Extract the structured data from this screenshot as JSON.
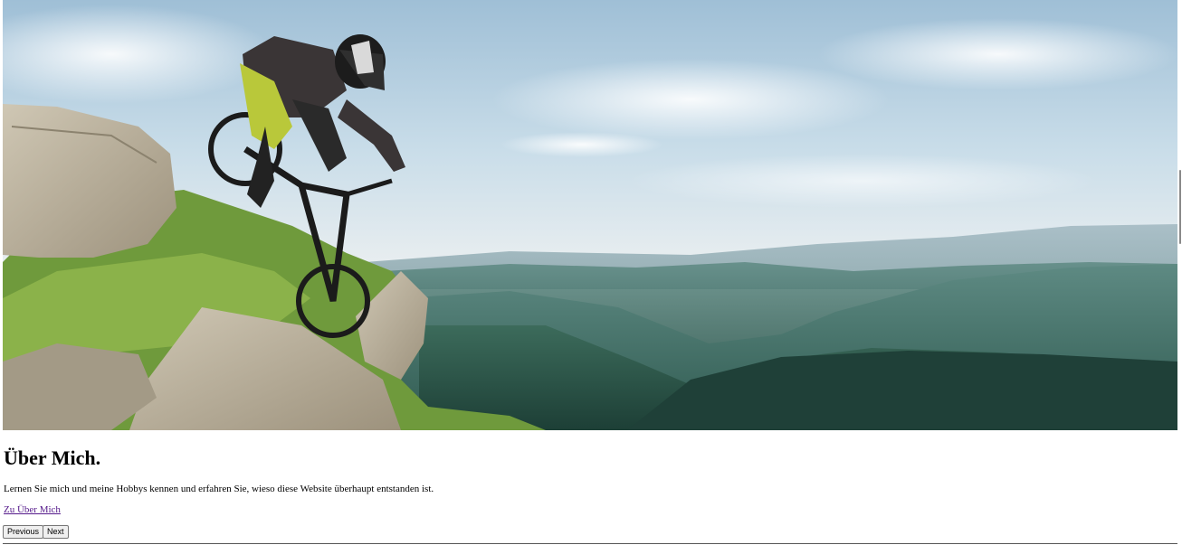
{
  "slide": {
    "image_alt": "Mountainbiker auf einem Felsen vor einer Berglandschaft",
    "title": "Über Mich.",
    "description": "Lernen Sie mich und meine Hobbys kennen und erfahren Sie, wieso diese Website überhaupt entstanden ist.",
    "link_label": "Zu Über Mich"
  },
  "controls": {
    "previous_label": "Previous",
    "next_label": "Next"
  },
  "colors": {
    "link": "#551a8b",
    "sky": "#cfe0ea",
    "mountains": "#3f6e63"
  }
}
